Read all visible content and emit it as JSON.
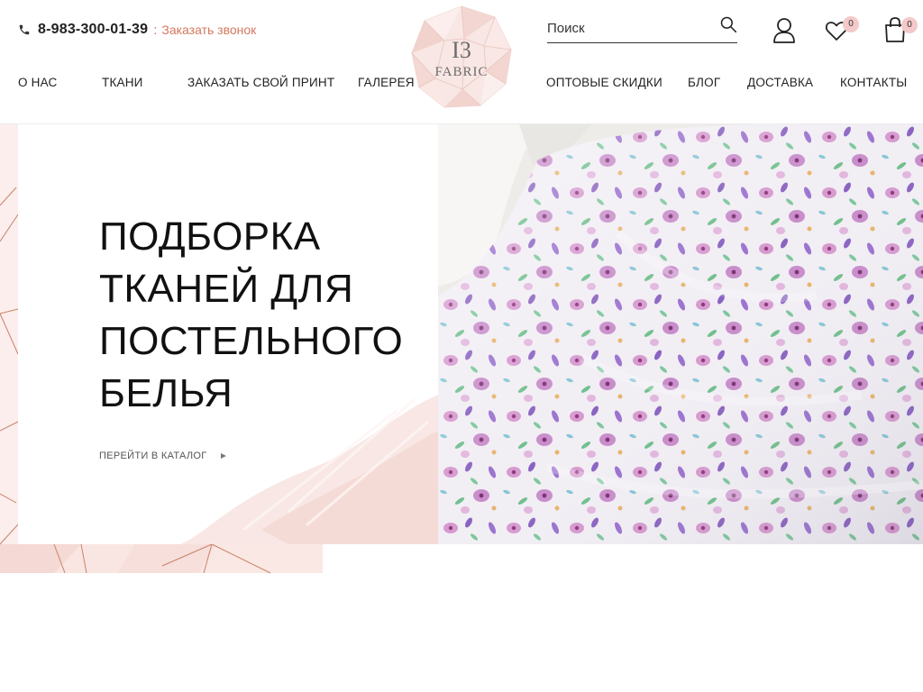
{
  "header": {
    "phone": "8-983-300-01-39",
    "phone_sep": ":",
    "callback_label": "Заказать звонок",
    "logo_number": "I3",
    "logo_brand": "FABRIC"
  },
  "search": {
    "placeholder": "Поиск"
  },
  "wishlist": {
    "count": "0"
  },
  "cart": {
    "count": "0"
  },
  "nav": {
    "items": [
      {
        "label": "О нас"
      },
      {
        "label": "Ткани"
      },
      {
        "label": "Заказать свой принт"
      },
      {
        "label": "Галерея"
      },
      {
        "label": "Оптовые скидки"
      },
      {
        "label": "Блог"
      },
      {
        "label": "Доставка"
      },
      {
        "label": "Контакты"
      }
    ]
  },
  "hero": {
    "title_lines": [
      "Подборка",
      "тканей для",
      "постельного",
      "белья"
    ],
    "cta_label": "Перейти в каталог"
  },
  "colors": {
    "accent": "#d4785f",
    "badge": "#f4c9c9",
    "pink_light": "#f7e3e0",
    "copper": "#c9826b"
  }
}
